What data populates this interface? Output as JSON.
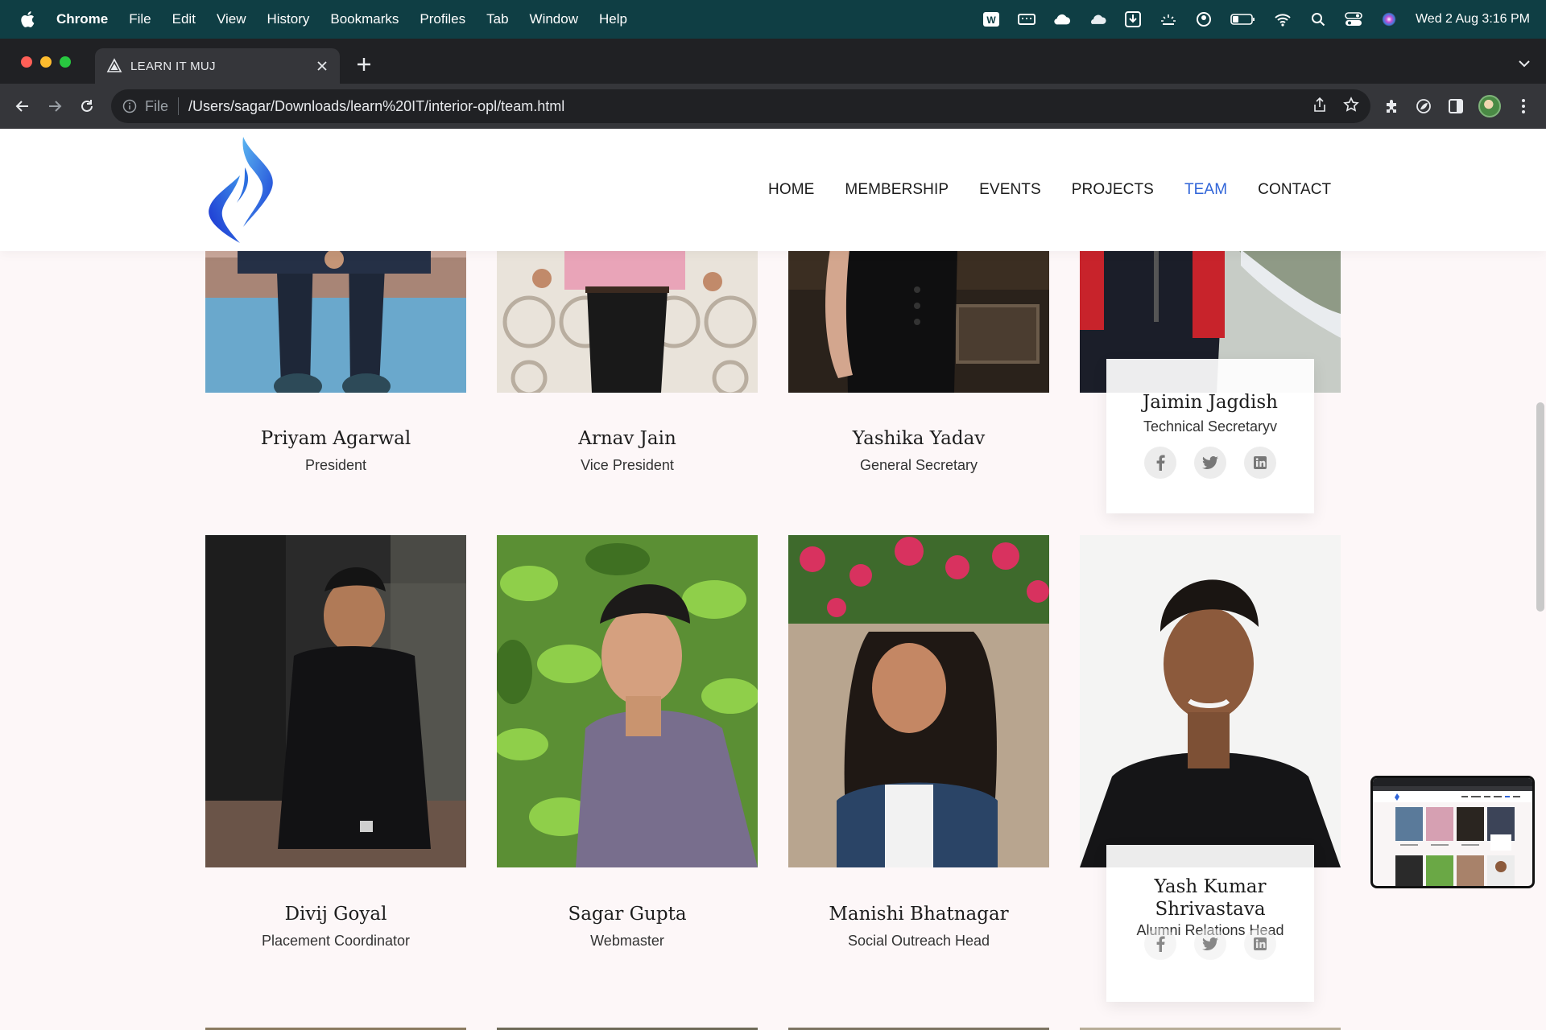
{
  "menubar": {
    "app_name": "Chrome",
    "menus": [
      "File",
      "Edit",
      "View",
      "History",
      "Bookmarks",
      "Profiles",
      "Tab",
      "Window",
      "Help"
    ],
    "clock": "Wed 2 Aug  3:16 PM"
  },
  "browser": {
    "tab_title": "LEARN IT MUJ",
    "scheme_label": "File",
    "url": "/Users/sagar/Downloads/learn%20IT/interior-opl/team.html"
  },
  "site": {
    "nav": [
      {
        "label": "HOME",
        "active": false
      },
      {
        "label": "MEMBERSHIP",
        "active": false
      },
      {
        "label": "EVENTS",
        "active": false
      },
      {
        "label": "PROJECTS",
        "active": false
      },
      {
        "label": "TEAM",
        "active": true
      },
      {
        "label": "CONTACT",
        "active": false
      }
    ],
    "accent_color": "#2f64d8"
  },
  "team": {
    "row1": [
      {
        "name": "Priyam Agarwal",
        "role": "President"
      },
      {
        "name": "Arnav Jain",
        "role": "Vice President"
      },
      {
        "name": "Yashika Yadav",
        "role": "General Secretary"
      },
      {
        "name": "Jaimin Jagdish",
        "role": "Technical Secretaryv"
      }
    ],
    "row2": [
      {
        "name": "Divij Goyal",
        "role": "Placement Coordinator"
      },
      {
        "name": "Sagar Gupta",
        "role": "Webmaster"
      },
      {
        "name": "Manishi Bhatnagar",
        "role": "Social Outreach Head"
      },
      {
        "name": "Yash Kumar Shrivastava",
        "role": "Alumni Relations Head"
      }
    ]
  }
}
